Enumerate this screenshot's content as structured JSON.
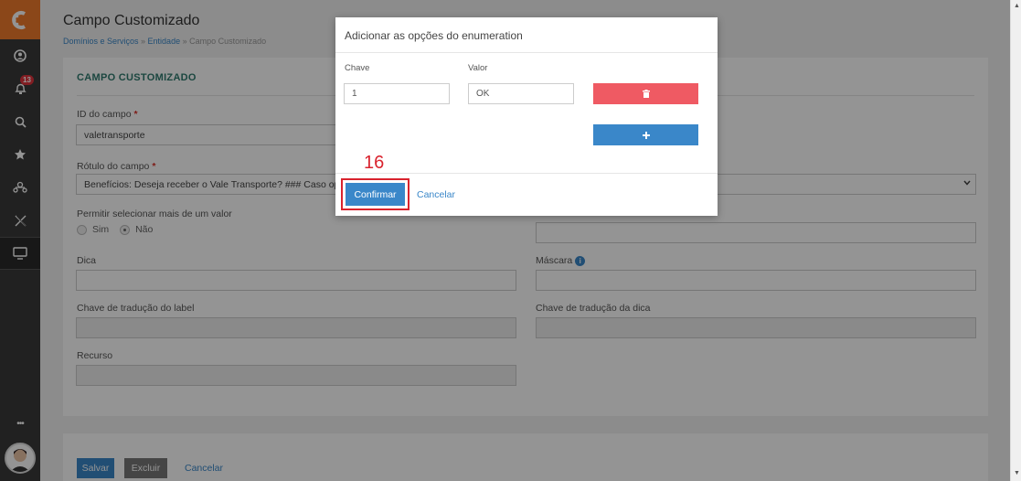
{
  "sidebar": {
    "notification_count": "13",
    "more_label": "•••",
    "icons": [
      "logo-icon",
      "user-circle-icon",
      "bell-icon",
      "search-icon",
      "star-icon",
      "network-icon",
      "x-icon",
      "monitor-icon"
    ]
  },
  "page": {
    "title": "Campo Customizado",
    "breadcrumb": {
      "item1": "Domínios e Serviços",
      "sep": " » ",
      "item2": "Entidade",
      "item3": "Campo Customizado"
    },
    "card_title": "CAMPO CUSTOMIZADO",
    "form": {
      "field_id_label": "ID do campo",
      "field_id_value": "valetransporte",
      "field_label_label": "Rótulo do campo",
      "field_label_value": "Benefícios: Deseja receber o Vale Transporte?   ### Caso op",
      "multi_label": "Permitir selecionar mais de um valor",
      "radio_yes": "Sim",
      "radio_no": "Não",
      "hint_label": "Dica",
      "mask_label": "Máscara",
      "label_translation_key": "Chave de tradução do label",
      "hint_translation_key": "Chave de tradução da dica",
      "resource_label": "Recurso",
      "required_mark": "*"
    },
    "footer": {
      "save": "Salvar",
      "delete": "Excluir",
      "cancel": "Cancelar"
    }
  },
  "modal": {
    "title": "Adicionar as opções do enumeration",
    "key_label": "Chave",
    "value_label": "Valor",
    "key_value": "1",
    "value_value": "OK",
    "confirm": "Confirmar",
    "cancel": "Cancelar",
    "step_number": "16"
  },
  "colors": {
    "accent": "#3a87c9",
    "logo": "#f07a2c",
    "danger": "#ef5a63",
    "highlight": "#d9232e",
    "section_title": "#2f7a6f"
  }
}
